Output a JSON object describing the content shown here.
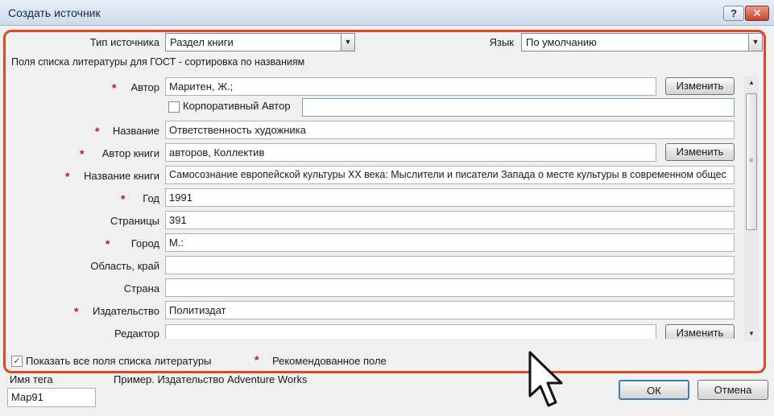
{
  "window": {
    "title": "Создать источник",
    "help_label": "?",
    "close_label": "✕"
  },
  "source_type": {
    "label": "Тип источника",
    "value": "Раздел книги"
  },
  "language": {
    "label": "Язык",
    "value": "По умолчанию"
  },
  "section_header": "Поля списка литературы для ГОСТ - сортировка по названиям",
  "fields": {
    "author": {
      "label": "Автор",
      "value": "Маритен, Ж.;",
      "button": "Изменить"
    },
    "corporate": {
      "label": "Корпоративный Автор",
      "checked": false,
      "value": ""
    },
    "title": {
      "label": "Название",
      "value": "Ответственность художника"
    },
    "book_author": {
      "label": "Автор книги",
      "value": "авторов, Коллектив",
      "button": "Изменить"
    },
    "book_title": {
      "label": "Название книги",
      "value": "Самосознание европейской культуры XX века: Мыслители и писатели Запада о месте культуры в современном общес"
    },
    "year": {
      "label": "Год",
      "value": "1991"
    },
    "pages": {
      "label": "Страницы",
      "value": "391"
    },
    "city": {
      "label": "Город",
      "value": "М.:"
    },
    "region": {
      "label": "Область, край",
      "value": ""
    },
    "country": {
      "label": "Страна",
      "value": ""
    },
    "publisher": {
      "label": "Издательство",
      "value": "Политиздат"
    },
    "editor": {
      "label": "Редактор",
      "value": "",
      "button": "Изменить"
    }
  },
  "footer": {
    "show_all_label": "Показать все поля списка литературы",
    "show_all_checked": true,
    "recommended_star": "*",
    "recommended_label": "Рекомендованное поле",
    "tag_label": "Имя тега",
    "tag_value": "Мар91",
    "example": "Пример. Издательство  Adventure Works",
    "ok_label": "ОК",
    "cancel_label": "Отмена"
  },
  "icons": {
    "dropdown": "chevron-down-icon",
    "checkmark": "checkmark-icon",
    "star": "required-star-icon",
    "cursor": "mouse-pointer-icon"
  },
  "colors": {
    "highlight": "#e0452a",
    "required_star": "#c0151d",
    "titlebar": "#cfdcec"
  }
}
